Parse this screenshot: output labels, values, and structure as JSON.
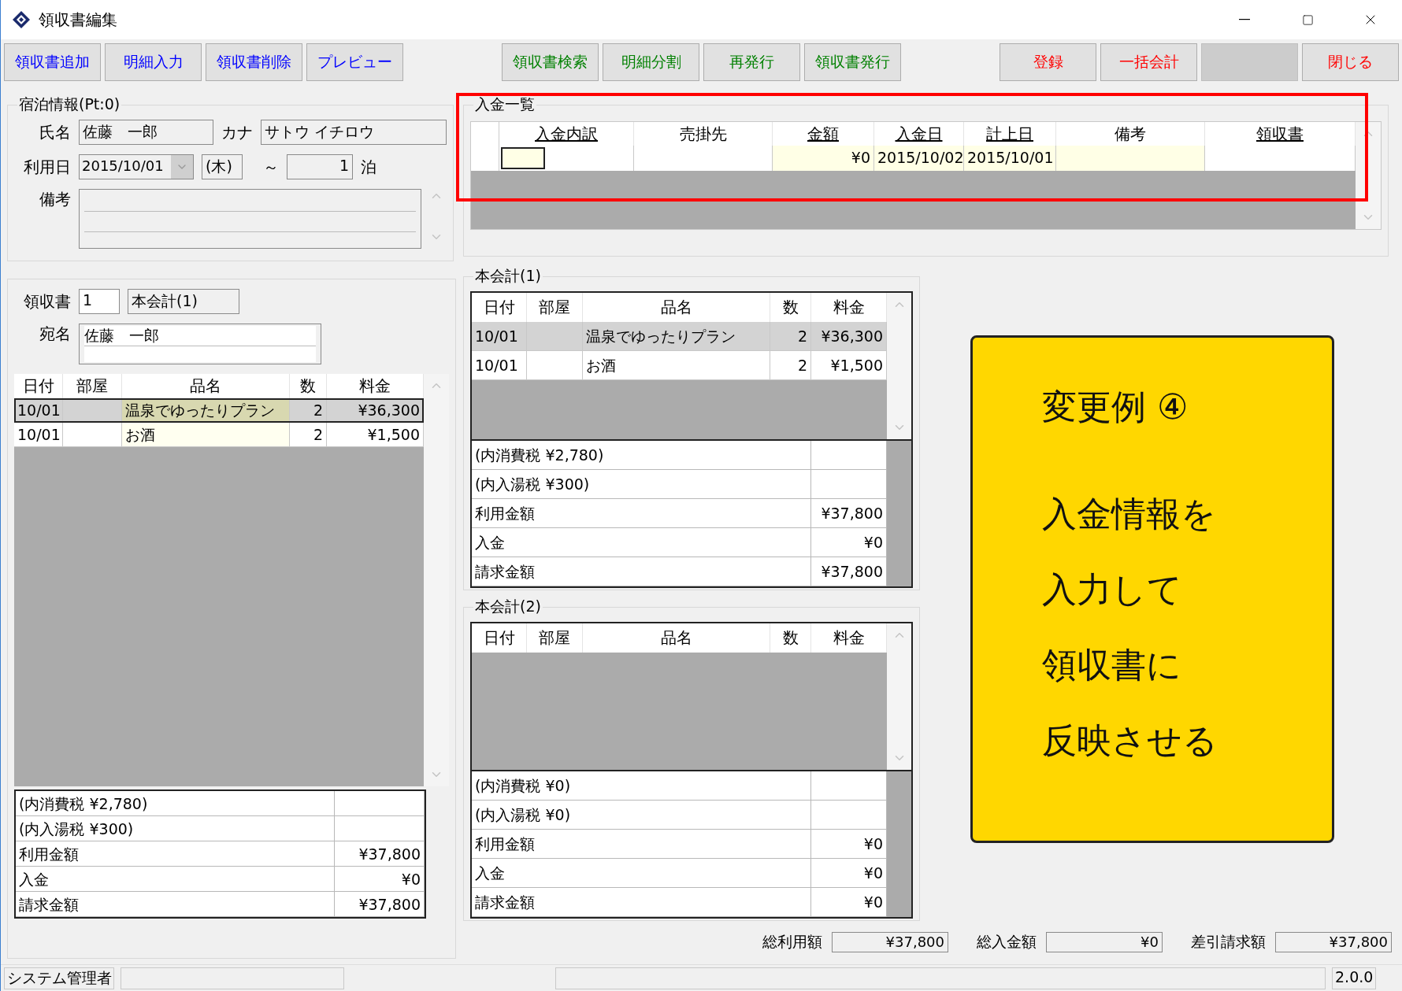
{
  "window": {
    "title": "領収書編集"
  },
  "toolbar": {
    "buttons": [
      {
        "label": "領収書追加",
        "color": "#0000ff",
        "disabled": false
      },
      {
        "label": "明細入力",
        "color": "#0000ff",
        "disabled": false
      },
      {
        "label": "領収書削除",
        "color": "#0000ff",
        "disabled": false
      },
      {
        "label": "プレビュー",
        "color": "#0000ff",
        "disabled": false
      },
      {
        "label": "領収書検索",
        "color": "#008000",
        "disabled": false
      },
      {
        "label": "明細分割",
        "color": "#008000",
        "disabled": false
      },
      {
        "label": "再発行",
        "color": "#008000",
        "disabled": false
      },
      {
        "label": "領収書発行",
        "color": "#008000",
        "disabled": false
      },
      {
        "label": "登録",
        "color": "#ff0000",
        "disabled": false
      },
      {
        "label": "一括会計",
        "color": "#ff0000",
        "disabled": false
      },
      {
        "disabled": true
      },
      {
        "label": "閉じる",
        "color": "#ff0000",
        "disabled": false
      }
    ]
  },
  "lodging": {
    "title": "宿泊情報(Pt:0)",
    "name_label": "氏名",
    "name": "佐藤　一郎",
    "kana_label": "カナ",
    "kana": "サトウ イチロウ",
    "date_label": "利用日",
    "date": "2015/10/01",
    "weekday": "(木)",
    "tilde": "～",
    "nights": "1",
    "nights_unit": "泊",
    "note_label": "備考"
  },
  "receipt": {
    "number_label": "領収書",
    "number": "1",
    "account": "本会計(1)",
    "addressee_label": "宛名",
    "addressee": "佐藤　一郎",
    "columns": [
      "日付",
      "部屋",
      "品名",
      "数",
      "料金"
    ],
    "rows": [
      {
        "date": "10/01",
        "item": "温泉でゆったりプラン",
        "qty": "2",
        "amount": "¥36,300",
        "selected": true
      },
      {
        "date": "10/01",
        "item": "お酒",
        "qty": "2",
        "amount": "¥1,500",
        "selected": false
      }
    ],
    "summary": [
      {
        "label": "(内消費税 ¥2,780)"
      },
      {
        "label": "(内入湯税 ¥300)"
      },
      {
        "label": "利用金額",
        "value": "¥37,800"
      },
      {
        "label": "入金",
        "value": "¥0"
      },
      {
        "label": "請求金額",
        "value": "¥37,800"
      }
    ]
  },
  "payments": {
    "title": "入金一覧",
    "highlighted": true,
    "columns": [
      {
        "label": "入金内訳",
        "underlined": true
      },
      {
        "label": "売掛先",
        "underlined": false
      },
      {
        "label": "金額",
        "underlined": true
      },
      {
        "label": "入金日",
        "underlined": true
      },
      {
        "label": "計上日",
        "underlined": true
      },
      {
        "label": "備考",
        "underlined": false
      },
      {
        "label": "領収書",
        "underlined": true
      }
    ],
    "rows": [
      {
        "amount": "¥0",
        "deposit_date": "2015/10/02",
        "booking_date": "2015/10/01"
      }
    ]
  },
  "accounts": [
    {
      "title": "本会計(1)",
      "columns": [
        "日付",
        "部屋",
        "品名",
        "数",
        "料金"
      ],
      "rows": [
        {
          "date": "10/01",
          "item": "温泉でゆったりプラン",
          "qty": "2",
          "amount": "¥36,300",
          "selected": true
        },
        {
          "date": "10/01",
          "item": "お酒",
          "qty": "2",
          "amount": "¥1,500",
          "selected": false
        }
      ],
      "summary": [
        {
          "label": "(内消費税 ¥2,780)"
        },
        {
          "label": "(内入湯税 ¥300)"
        },
        {
          "label": "利用金額",
          "value": "¥37,800"
        },
        {
          "label": "入金",
          "value": "¥0"
        },
        {
          "label": "請求金額",
          "value": "¥37,800"
        }
      ]
    },
    {
      "title": "本会計(2)",
      "columns": [
        "日付",
        "部屋",
        "品名",
        "数",
        "料金"
      ],
      "summary": [
        {
          "label": "(内消費税 ¥0)"
        },
        {
          "label": "(内入湯税 ¥0)"
        },
        {
          "label": "利用金額",
          "value": "¥0"
        },
        {
          "label": "入金",
          "value": "¥0"
        },
        {
          "label": "請求金額",
          "value": "¥0"
        }
      ]
    }
  ],
  "callout": {
    "heading": "変更例 ④",
    "lines": [
      "入金情報を",
      "入力して",
      "領収書に",
      "反映させる"
    ]
  },
  "totals": [
    {
      "label": "総利用額",
      "value": "¥37,800"
    },
    {
      "label": "総入金額",
      "value": "¥0"
    },
    {
      "label": "差引請求額",
      "value": "¥37,800"
    }
  ],
  "status_bar": {
    "user": "システム管理者",
    "version": "2.0.0"
  }
}
